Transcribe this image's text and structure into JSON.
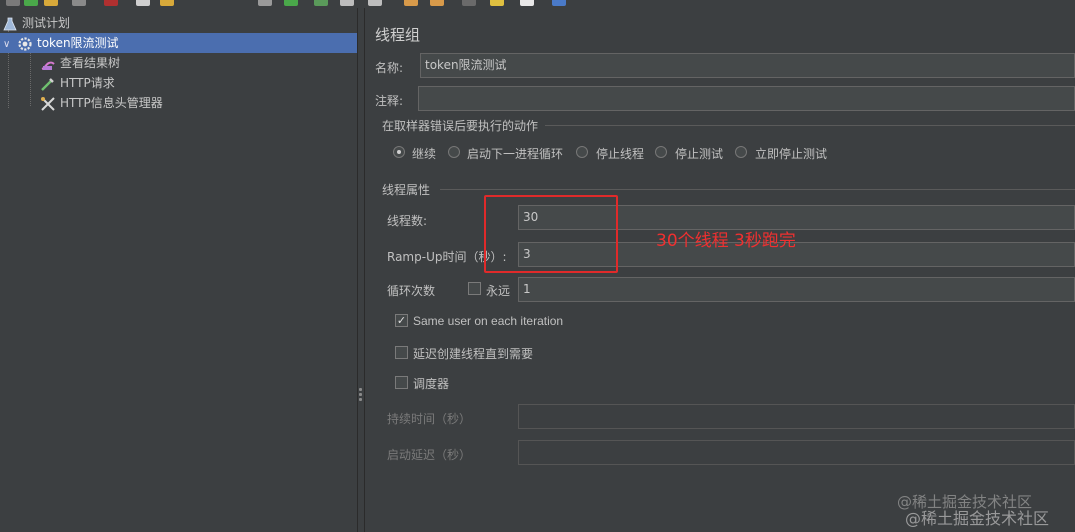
{
  "tree": {
    "items": [
      {
        "label": "测试计划",
        "icon": "test-plan-icon"
      },
      {
        "label": "token限流测试",
        "icon": "thread-group-gear-icon",
        "selected": true
      },
      {
        "label": "查看结果树",
        "icon": "results-tree-icon"
      },
      {
        "label": "HTTP请求",
        "icon": "http-request-pipette-icon"
      },
      {
        "label": "HTTP信息头管理器",
        "icon": "header-manager-tools-icon"
      }
    ]
  },
  "panel": {
    "title": "线程组",
    "name_label": "名称:",
    "name_value": "token限流测试",
    "comment_label": "注释:",
    "comment_value": "",
    "error_action": {
      "legend": "在取样器错误后要执行的动作",
      "options": [
        "继续",
        "启动下一进程循环",
        "停止线程",
        "停止测试",
        "立即停止测试"
      ],
      "selected": "继续"
    },
    "thread_props": {
      "legend": "线程属性",
      "threads_label": "线程数:",
      "threads_value": "30",
      "rampup_label": "Ramp-Up时间（秒）:",
      "rampup_value": "3",
      "loop_label": "循环次数",
      "forever_label": "永远",
      "forever_checked": false,
      "loop_value": "1",
      "same_user_label": "Same user on each iteration",
      "same_user_checked": true,
      "delay_label": "延迟创建线程直到需要",
      "delay_checked": false,
      "scheduler_label": "调度器",
      "scheduler_checked": false,
      "duration_label": "持续时间（秒）",
      "duration_value": "",
      "startup_delay_label": "启动延迟（秒）",
      "startup_delay_value": ""
    }
  },
  "annotation": {
    "text": "30个线程 3秒跑完",
    "color": "#e02a2a"
  },
  "watermark": {
    "line1": "@稀土掘金技术社区",
    "line2": "@稀土掘金技术社区"
  },
  "colors": {
    "background": "#3c3f41",
    "selection": "#4b6eaf",
    "field": "#45494a"
  }
}
